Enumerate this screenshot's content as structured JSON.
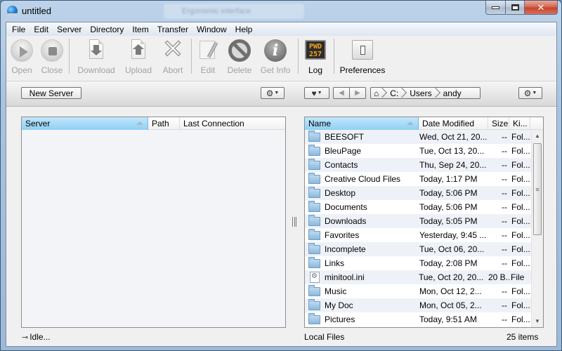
{
  "window": {
    "title": "untitled",
    "background_tab_title": "Ergonomic interface",
    "controls": {
      "minimize": "minimize",
      "maximize": "maximize",
      "close": "✕"
    }
  },
  "menu": [
    "File",
    "Edit",
    "Server",
    "Directory",
    "Item",
    "Transfer",
    "Window",
    "Help"
  ],
  "toolbar": {
    "open": {
      "label": "Open",
      "icon": "play-icon",
      "enabled": false
    },
    "close": {
      "label": "Close",
      "icon": "stop-icon",
      "enabled": false
    },
    "download": {
      "label": "Download",
      "icon": "download-icon",
      "enabled": false
    },
    "upload": {
      "label": "Upload",
      "icon": "upload-icon",
      "enabled": false
    },
    "abort": {
      "label": "Abort",
      "icon": "x-icon",
      "enabled": false
    },
    "edit": {
      "label": "Edit",
      "icon": "pencil-icon",
      "enabled": false
    },
    "delete": {
      "label": "Delete",
      "icon": "no-sign-icon",
      "enabled": false
    },
    "get_info": {
      "label": "Get Info",
      "icon": "info-icon",
      "enabled": false
    },
    "log": {
      "label": "Log",
      "icon": "log-icon",
      "icon_text_1": "PWD",
      "icon_text_2": "257",
      "enabled": true
    },
    "preferences": {
      "label": "Preferences",
      "icon": "switch-icon",
      "enabled": true
    }
  },
  "left_panel": {
    "new_server_label": "New Server",
    "gear_menu": "⚙",
    "columns": [
      "Server",
      "Path",
      "Last Connection"
    ],
    "sorted_column": "Server",
    "rows": [],
    "status": "Idle..."
  },
  "right_panel": {
    "favorites_icon": "♥",
    "back": "◀",
    "forward": "▶",
    "home_icon": "home-icon",
    "breadcrumb": [
      "C:",
      "Users",
      "andy"
    ],
    "gear_menu": "⚙",
    "columns": [
      "Name",
      "Date Modified",
      "Size",
      "Ki..."
    ],
    "sorted_column": "Name",
    "rows": [
      {
        "name": "BEESOFT",
        "date": "Wed, Oct 21, 20...",
        "size": "--",
        "kind": "Fol...",
        "type": "folder"
      },
      {
        "name": "BleuPage",
        "date": "Tue, Oct 13, 20...",
        "size": "--",
        "kind": "Fol...",
        "type": "folder"
      },
      {
        "name": "Contacts",
        "date": "Thu, Sep 24, 20...",
        "size": "--",
        "kind": "Fol...",
        "type": "folder"
      },
      {
        "name": "Creative Cloud Files",
        "date": "Today, 1:17 PM",
        "size": "--",
        "kind": "Fol...",
        "type": "folder"
      },
      {
        "name": "Desktop",
        "date": "Today, 5:06 PM",
        "size": "--",
        "kind": "Fol...",
        "type": "folder"
      },
      {
        "name": "Documents",
        "date": "Today, 5:06 PM",
        "size": "--",
        "kind": "Fol...",
        "type": "folder"
      },
      {
        "name": "Downloads",
        "date": "Today, 5:05 PM",
        "size": "--",
        "kind": "Fol...",
        "type": "folder"
      },
      {
        "name": "Favorites",
        "date": "Yesterday, 9:45 ...",
        "size": "--",
        "kind": "Fol...",
        "type": "folder"
      },
      {
        "name": "Incomplete",
        "date": "Tue, Oct 06, 20...",
        "size": "--",
        "kind": "Fol...",
        "type": "folder"
      },
      {
        "name": "Links",
        "date": "Today, 2:08 PM",
        "size": "--",
        "kind": "Fol...",
        "type": "folder"
      },
      {
        "name": "minitool.ini",
        "date": "Tue, Oct 20, 20...",
        "size": "20 B...",
        "kind": "File",
        "type": "file"
      },
      {
        "name": "Music",
        "date": "Mon, Oct 12, 2...",
        "size": "--",
        "kind": "Fol...",
        "type": "folder"
      },
      {
        "name": "My Doc",
        "date": "Mon, Oct 05, 2...",
        "size": "--",
        "kind": "Fol...",
        "type": "folder"
      },
      {
        "name": "Pictures",
        "date": "Today, 9:51 AM",
        "size": "--",
        "kind": "Fol...",
        "type": "folder"
      }
    ],
    "status_left": "Local Files",
    "status_right": "25 items"
  }
}
